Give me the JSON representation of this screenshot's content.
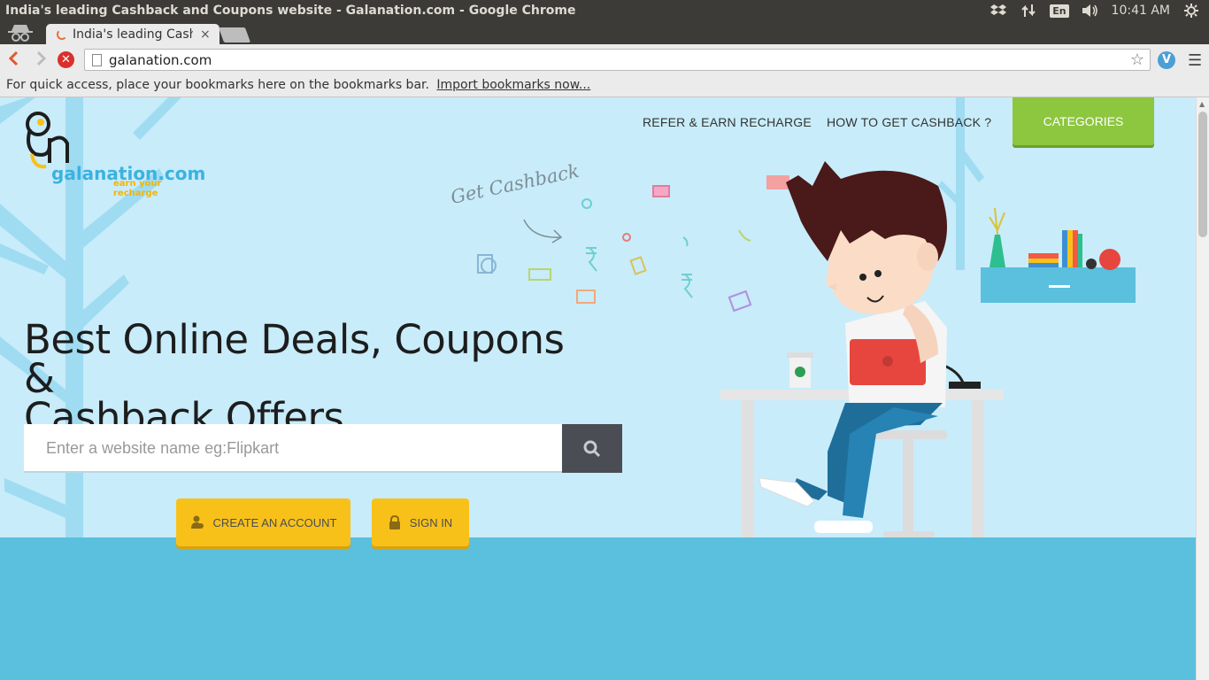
{
  "os": {
    "window_title": "India's leading Cashback and Coupons website - Galanation.com - Google Chrome",
    "lang": "En",
    "time": "10:41 AM"
  },
  "browser": {
    "tab_title": "India's leading Cashb",
    "tab_close": "×",
    "url": "galanation.com",
    "bookmarks_prompt": "For quick access, place your bookmarks here on the bookmarks bar.",
    "bookmarks_link": "Import bookmarks now..."
  },
  "site": {
    "logo_text": "galanation.com",
    "logo_tagline": "earn your recharge",
    "nav": {
      "refer": "REFER & EARN RECHARGE",
      "how": "HOW TO GET CASHBACK ?",
      "categories": "CATEGORIES"
    },
    "hero_line1": "Best Online Deals, Coupons &",
    "hero_line2": "Cashback Offers",
    "search_placeholder": "Enter a website name eg:Flipkart",
    "search_value": "",
    "create_account": "CREATE AN ACCOUNT",
    "sign_in": "SIGN IN",
    "cashback_doodle": "Get Cashback"
  },
  "colors": {
    "sky": "#c8ecfa",
    "floor": "#5bbfde",
    "categories_green": "#8dc63f",
    "cta_yellow": "#f8c11a",
    "search_dark": "#4a4d53"
  },
  "icons": [
    "incognito-icon",
    "dropbox-icon",
    "network-icon",
    "volume-icon",
    "gear-icon",
    "back-icon",
    "forward-icon",
    "stop-icon",
    "star-icon",
    "extension-icon",
    "menu-icon",
    "search-icon",
    "user-add-icon",
    "lock-icon"
  ]
}
